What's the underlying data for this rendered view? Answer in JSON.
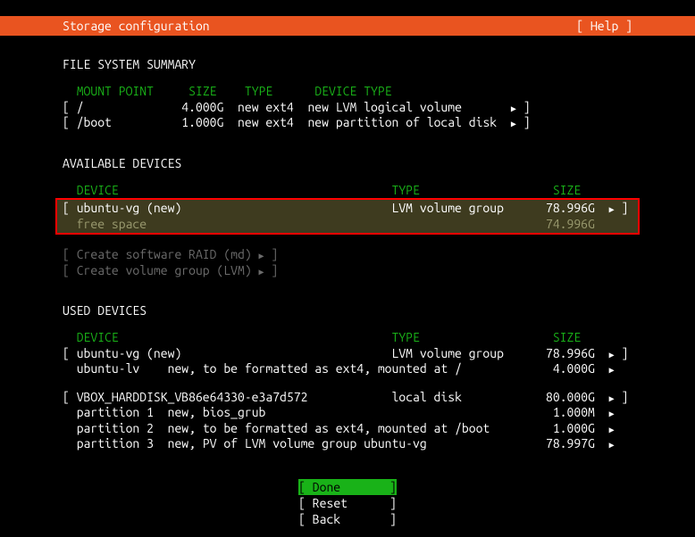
{
  "header": {
    "title": "Storage configuration",
    "help": "[ Help ]"
  },
  "sections": {
    "fs_summary": {
      "title": "FILE SYSTEM SUMMARY",
      "headers": {
        "mount": "MOUNT POINT",
        "size": "SIZE",
        "type": "TYPE",
        "device_type": "DEVICE TYPE"
      },
      "rows": [
        {
          "mount": "/",
          "size": "4.000G",
          "type": "new ext4",
          "device_type": "new LVM logical volume"
        },
        {
          "mount": "/boot",
          "size": "1.000G",
          "type": "new ext4",
          "device_type": "new partition of local disk"
        }
      ]
    },
    "available": {
      "title": "AVAILABLE DEVICES",
      "headers": {
        "device": "DEVICE",
        "type": "TYPE",
        "size": "SIZE"
      },
      "highlighted": {
        "device": "ubuntu-vg (new)",
        "type": "LVM volume group",
        "size": "78.996G",
        "sub_device": "free space",
        "sub_size": "74.996G"
      },
      "actions": {
        "raid": "Create software RAID (md)",
        "lvm": "Create volume group (LVM)"
      }
    },
    "used": {
      "title": "USED DEVICES",
      "headers": {
        "device": "DEVICE",
        "type": "TYPE",
        "size": "SIZE"
      },
      "vg": {
        "device": "ubuntu-vg (new)",
        "type": "LVM volume group",
        "size": "78.996G",
        "lv_name": "ubuntu-lv",
        "lv_desc": "new, to be formatted as ext4, mounted at /",
        "lv_size": "4.000G"
      },
      "disk": {
        "device": "VBOX_HARDDISK_VB86e64330-e3a7d572",
        "type": "local disk",
        "size": "80.000G",
        "p1_name": "partition 1",
        "p1_desc": "new, bios_grub",
        "p1_size": "1.000M",
        "p2_name": "partition 2",
        "p2_desc": "new, to be formatted as ext4, mounted at /boot",
        "p2_size": "1.000G",
        "p3_name": "partition 3",
        "p3_desc": "new, PV of LVM volume group ubuntu-vg",
        "p3_size": "78.997G"
      }
    }
  },
  "footer": {
    "done": "Done",
    "reset": "Reset",
    "back": "Back"
  }
}
